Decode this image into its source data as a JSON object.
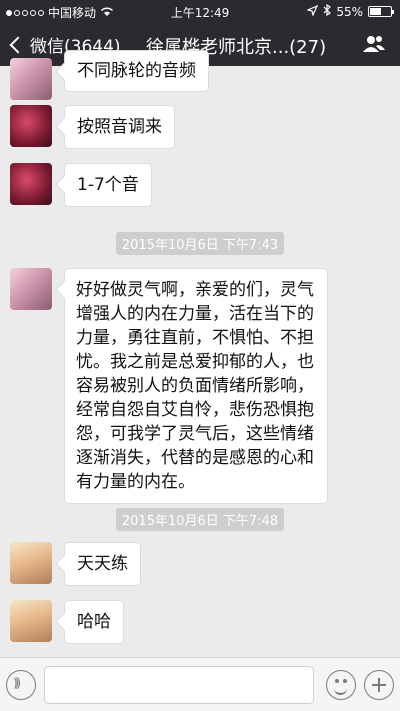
{
  "status_bar": {
    "carrier": "中国移动",
    "time": "上午12:49",
    "battery": "55%",
    "battery_level": 0.55
  },
  "nav": {
    "back_label": "微信(3644)",
    "title": "徐属桦老师北京...(27)"
  },
  "messages": [
    {
      "text": "不同脉轮的音频"
    },
    {
      "text": "按照音调来"
    },
    {
      "text": "1-7个音"
    },
    {
      "timestamp": "2015年10月6日 下午7:43"
    },
    {
      "text": "好好做灵气啊，亲爱的们，灵气增强人的内在力量，活在当下的力量，勇往直前，不惧怕、不担忧。我之前是总爱抑郁的人，也容易被别人的负面情绪所影响，经常自怨自艾自怜，悲伤恐惧抱怨，可我学了灵气后，这些情绪逐渐消失，代替的是感恩的心和有力量的内在。",
      "lines": [
        "好好做灵气啊，亲爱的们，灵气",
        "增强人的内在力量，活在当下的",
        "力量，勇往直前，不惧怕、不担",
        "忧。我之前是总爱抑郁的人，也",
        "容易被别人的负面情绪所影响，",
        "经常自怨自艾自怜，悲伤恐惧抱",
        "怨，可我学了灵气后，这些情绪",
        "逐渐消失，代替的是感恩的心和",
        "有力量的内在。"
      ]
    },
    {
      "timestamp": "2015年10月6日 下午7:48"
    },
    {
      "text": "天天练"
    },
    {
      "text": "哈哈"
    }
  ]
}
